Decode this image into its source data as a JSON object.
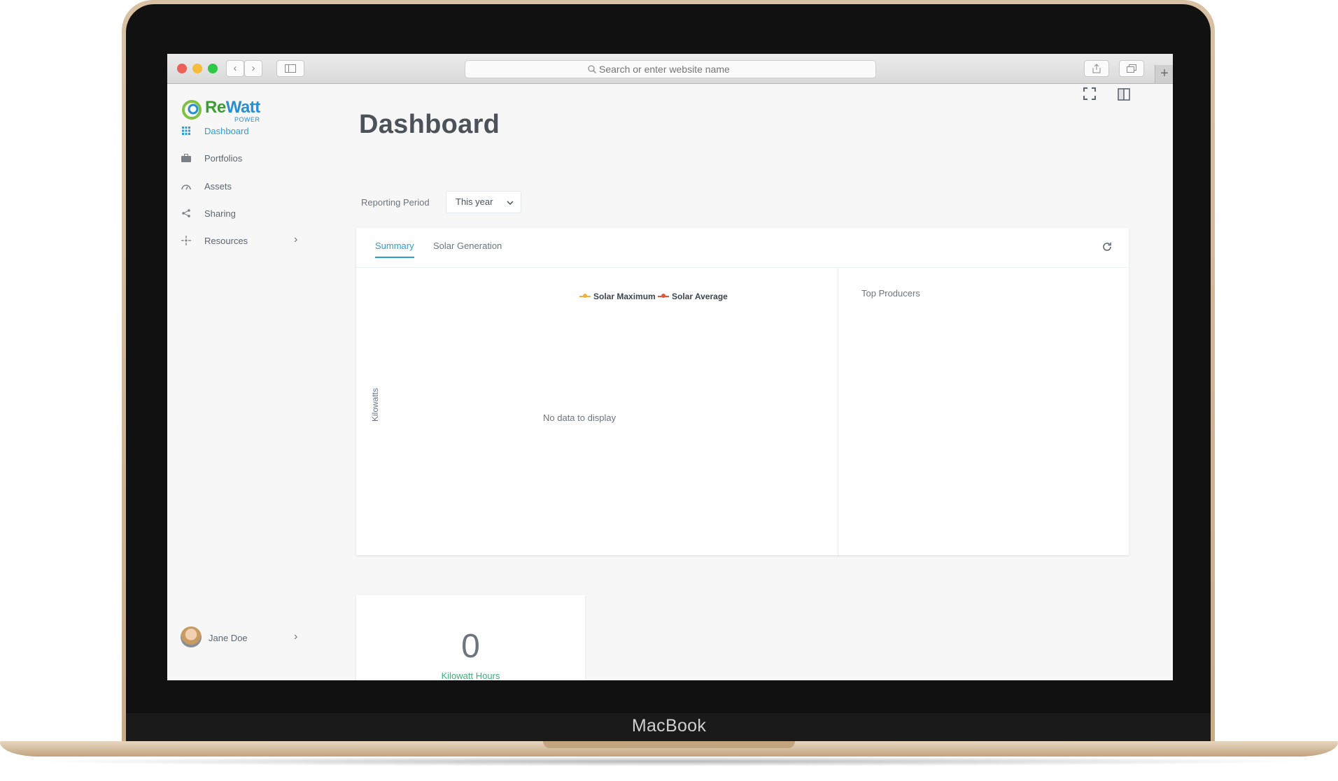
{
  "device": {
    "brand": "MacBook"
  },
  "browser": {
    "search_placeholder": "Search or enter website name",
    "colors": {
      "close": "#ee5f58",
      "minimize": "#f6bd3b",
      "maximize": "#2ec845"
    }
  },
  "logo": {
    "name_part1": "Re",
    "name_part2": "Watt",
    "sub": "POWER"
  },
  "sidebar": {
    "items": [
      {
        "label": "Dashboard",
        "icon": "grid-icon",
        "active": true
      },
      {
        "label": "Portfolios",
        "icon": "briefcase-icon",
        "active": false
      },
      {
        "label": "Assets",
        "icon": "gauge-icon",
        "active": false
      },
      {
        "label": "Sharing",
        "icon": "share-icon",
        "active": false
      },
      {
        "label": "Resources",
        "icon": "sparkle-icon",
        "active": false
      }
    ]
  },
  "user": {
    "name": "Jane Doe"
  },
  "page": {
    "title": "Dashboard"
  },
  "filters": {
    "reporting_label": "Reporting Period",
    "period_value": "This year"
  },
  "card": {
    "tabs": [
      {
        "label": "Summary",
        "active": true
      },
      {
        "label": "Solar Generation",
        "active": false
      }
    ],
    "legend": [
      {
        "name": "Solar Maximum",
        "color": "#f0b23a"
      },
      {
        "name": "Solar Average",
        "color": "#e8553d"
      }
    ],
    "ylabel": "Kilowatts",
    "empty_message": "No data to display",
    "top_producers_title": "Top Producers"
  },
  "kwh": {
    "value": "0",
    "label": "Kilowatt Hours"
  },
  "accent_color": "#2a9fd6"
}
